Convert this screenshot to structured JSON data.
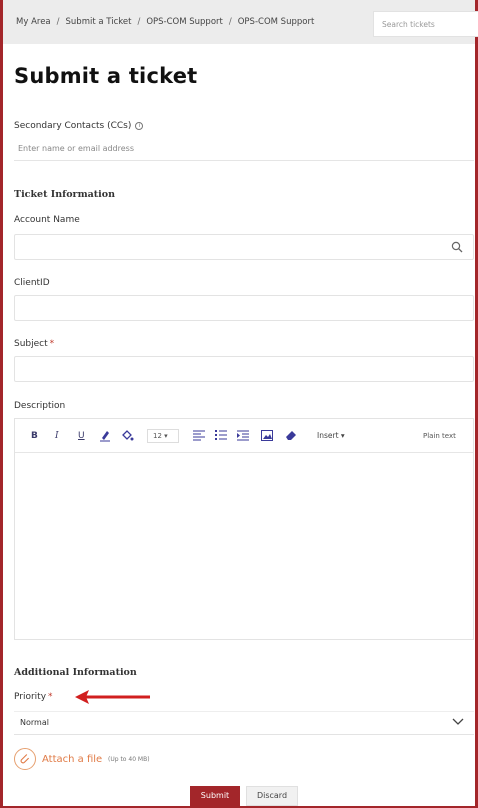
{
  "breadcrumb": [
    "My Area",
    "Submit a Ticket",
    "OPS-COM Support",
    "OPS-COM Support"
  ],
  "search": {
    "placeholder": "Search tickets"
  },
  "page_title": "Submit a ticket",
  "cc": {
    "label": "Secondary Contacts (CCs)",
    "placeholder": "Enter name or email address"
  },
  "ticket_section": "Ticket Information",
  "fields": {
    "account_name": "Account Name",
    "client_id": "ClientID",
    "subject": "Subject",
    "description": "Description"
  },
  "required_mark": "*",
  "editor": {
    "font_size": "12",
    "insert_label": "Insert",
    "plain_text_label": "Plain text",
    "buttons": {
      "bold": "B",
      "italic": "I",
      "underline": "U"
    }
  },
  "additional_section": "Additional Information",
  "priority": {
    "label": "Priority",
    "value": "Normal"
  },
  "attach": {
    "label": "Attach a file",
    "note": "(Up to 40 MB)"
  },
  "actions": {
    "submit": "Submit",
    "discard": "Discard"
  },
  "colors": {
    "brand": "#a3262a",
    "accent_orange": "#e07a45",
    "annotation_arrow": "#d11f1f"
  }
}
